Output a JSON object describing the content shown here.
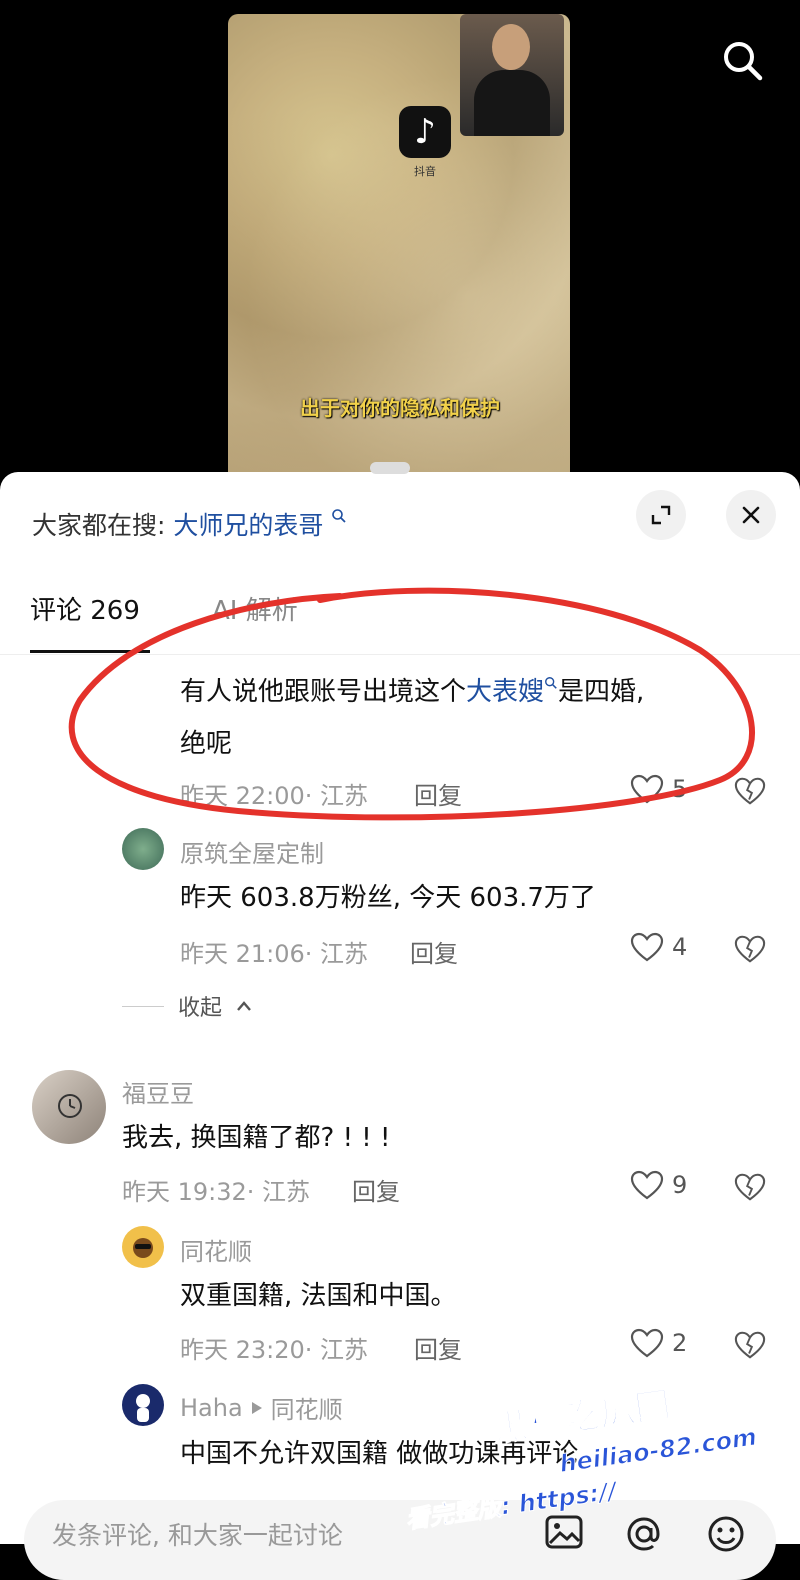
{
  "video": {
    "app_logo_glyph": "♪",
    "app_logo_name": "抖音",
    "subtitle": "出于对你的隐私和保护",
    "search_icon": "search-icon"
  },
  "sheet": {
    "hot_search_prefix": "大家都在搜:",
    "hot_search_term": "大师兄的表哥",
    "expand_icon": "expand-icon",
    "close_icon": "close-icon"
  },
  "tabs": {
    "comments_label": "评论 269",
    "ai_label": "AI 解析"
  },
  "comments": [
    {
      "text_before": "有人说他跟账号出境这个",
      "text_link": "大表嫂",
      "text_after": "是四婚,",
      "text_line2": "绝呢",
      "meta": "昨天 22:00· 江苏",
      "reply": "回复",
      "likes": "5"
    },
    {
      "user": "原筑全屋定制",
      "text": "昨天 603.8万粉丝, 今天 603.7万了",
      "meta": "昨天 21:06· 江苏",
      "reply": "回复",
      "likes": "4"
    },
    {
      "user": "福豆豆",
      "text": "我去, 换国籍了都? ! ! !",
      "meta": "昨天 19:32· 江苏",
      "reply": "回复",
      "likes": "9"
    },
    {
      "user": "同花顺",
      "text": "双重国籍, 法国和中国。",
      "meta": "昨天 23:20· 江苏",
      "reply": "回复",
      "likes": "2"
    },
    {
      "user": "Haha",
      "reply_to": "同花顺",
      "text": "中国不允许双国籍 做做功课再评论"
    }
  ],
  "collapse_label": "收起",
  "input": {
    "placeholder": "发条评论, 和大家一起讨论"
  },
  "watermark": {
    "line1": "黑料吃瓜网",
    "line2": "heiliao-82.com",
    "line3": "看完整版: https://"
  },
  "colors": {
    "link": "#1f4fa0",
    "annotation_red": "#e4322b",
    "watermark_blue": "#2a55d8"
  }
}
